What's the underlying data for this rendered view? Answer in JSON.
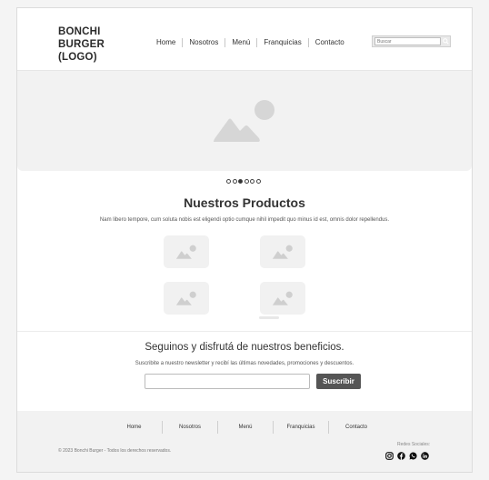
{
  "header": {
    "logo_lines": [
      "BONCHI",
      "BURGER",
      "(LOGO)"
    ],
    "nav": [
      "Home",
      "Nosotros",
      "Menú",
      "Franquicias",
      "Contacto"
    ],
    "search_placeholder": "Buscar"
  },
  "hero": {
    "image_icon": "image-placeholder-icon",
    "slides": 6,
    "active_slide": 3
  },
  "products": {
    "title": "Nuestros Productos",
    "description": "Nam libero tempore, cum soluta nobis est eligendi optio cumque nihil impedit quo minus id est, omnis dolor repellendus."
  },
  "newsletter": {
    "title": "Seguinos y disfrutá de nuestros beneficios.",
    "description": "Suscribite a nuestro newsletter y recibí las últimas novedades, promociones y descuentos.",
    "button": "Suscribir"
  },
  "footer": {
    "nav": [
      "Home",
      "Nosotros",
      "Menú",
      "Franquicias",
      "Contacto"
    ],
    "copyright": "© 2023 Bonchi Burger - Todos los derechos reservados.",
    "social_label": "Redes Sociales:",
    "social_icons": [
      "instagram-icon",
      "facebook-icon",
      "whatsapp-icon",
      "linkedin-icon"
    ]
  },
  "colors": {
    "button": "#555555",
    "placeholder": "#d6d6d6",
    "background": "#f2f2f2"
  }
}
